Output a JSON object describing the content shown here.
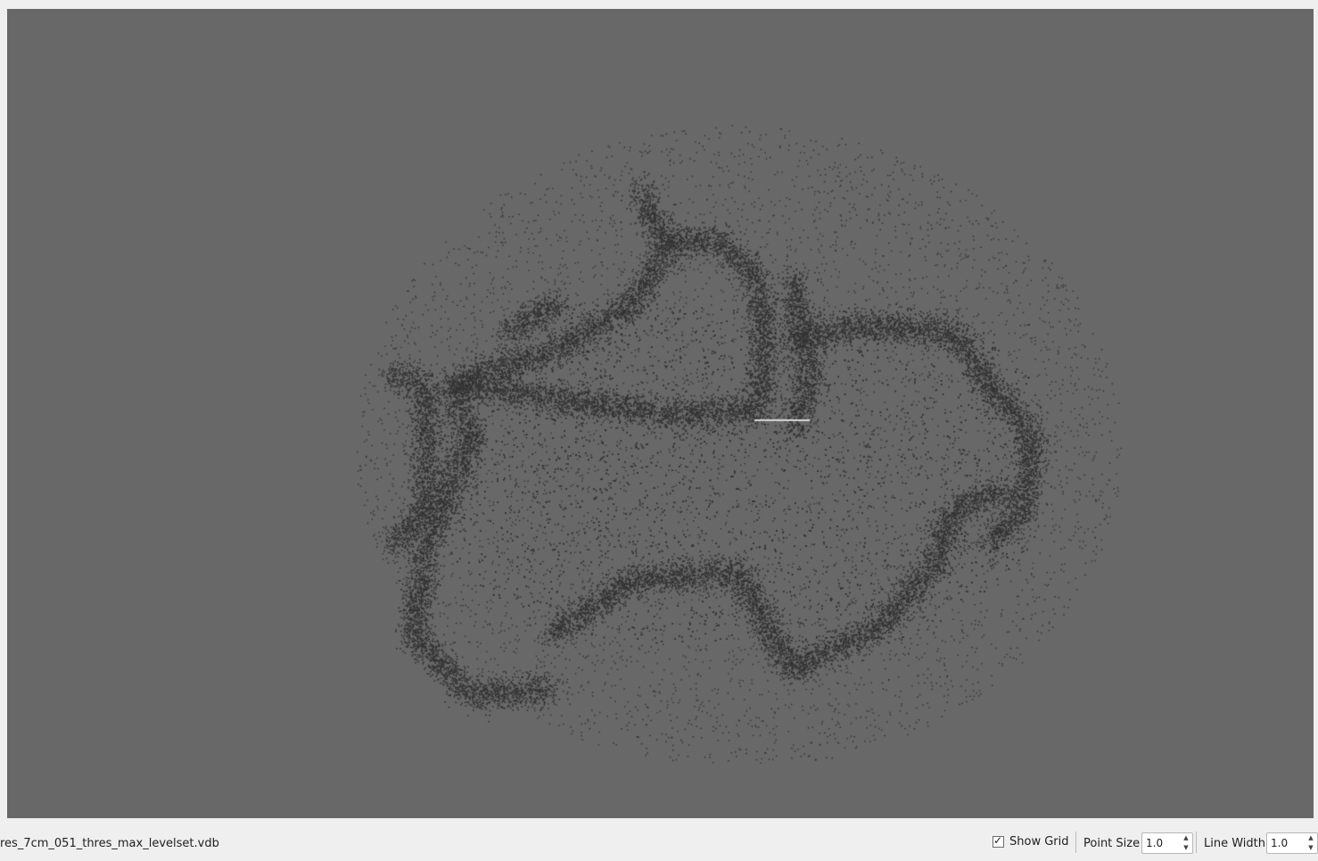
{
  "viewport": {
    "background": "#686868",
    "point_color": "#333333",
    "trajectory_color": "#d9d9d9"
  },
  "status": {
    "file_name": "res_7cm_051_thres_max_levelset.vdb"
  },
  "controls": {
    "show_grid": {
      "label": "Show Grid",
      "checked": true,
      "check_glyph": "✓"
    },
    "point_size": {
      "label": "Point Size",
      "value": "1.0"
    },
    "line_width": {
      "label": "Line Width",
      "value": "1.0"
    },
    "spin_up_glyph": "▲",
    "spin_down_glyph": "▼"
  }
}
